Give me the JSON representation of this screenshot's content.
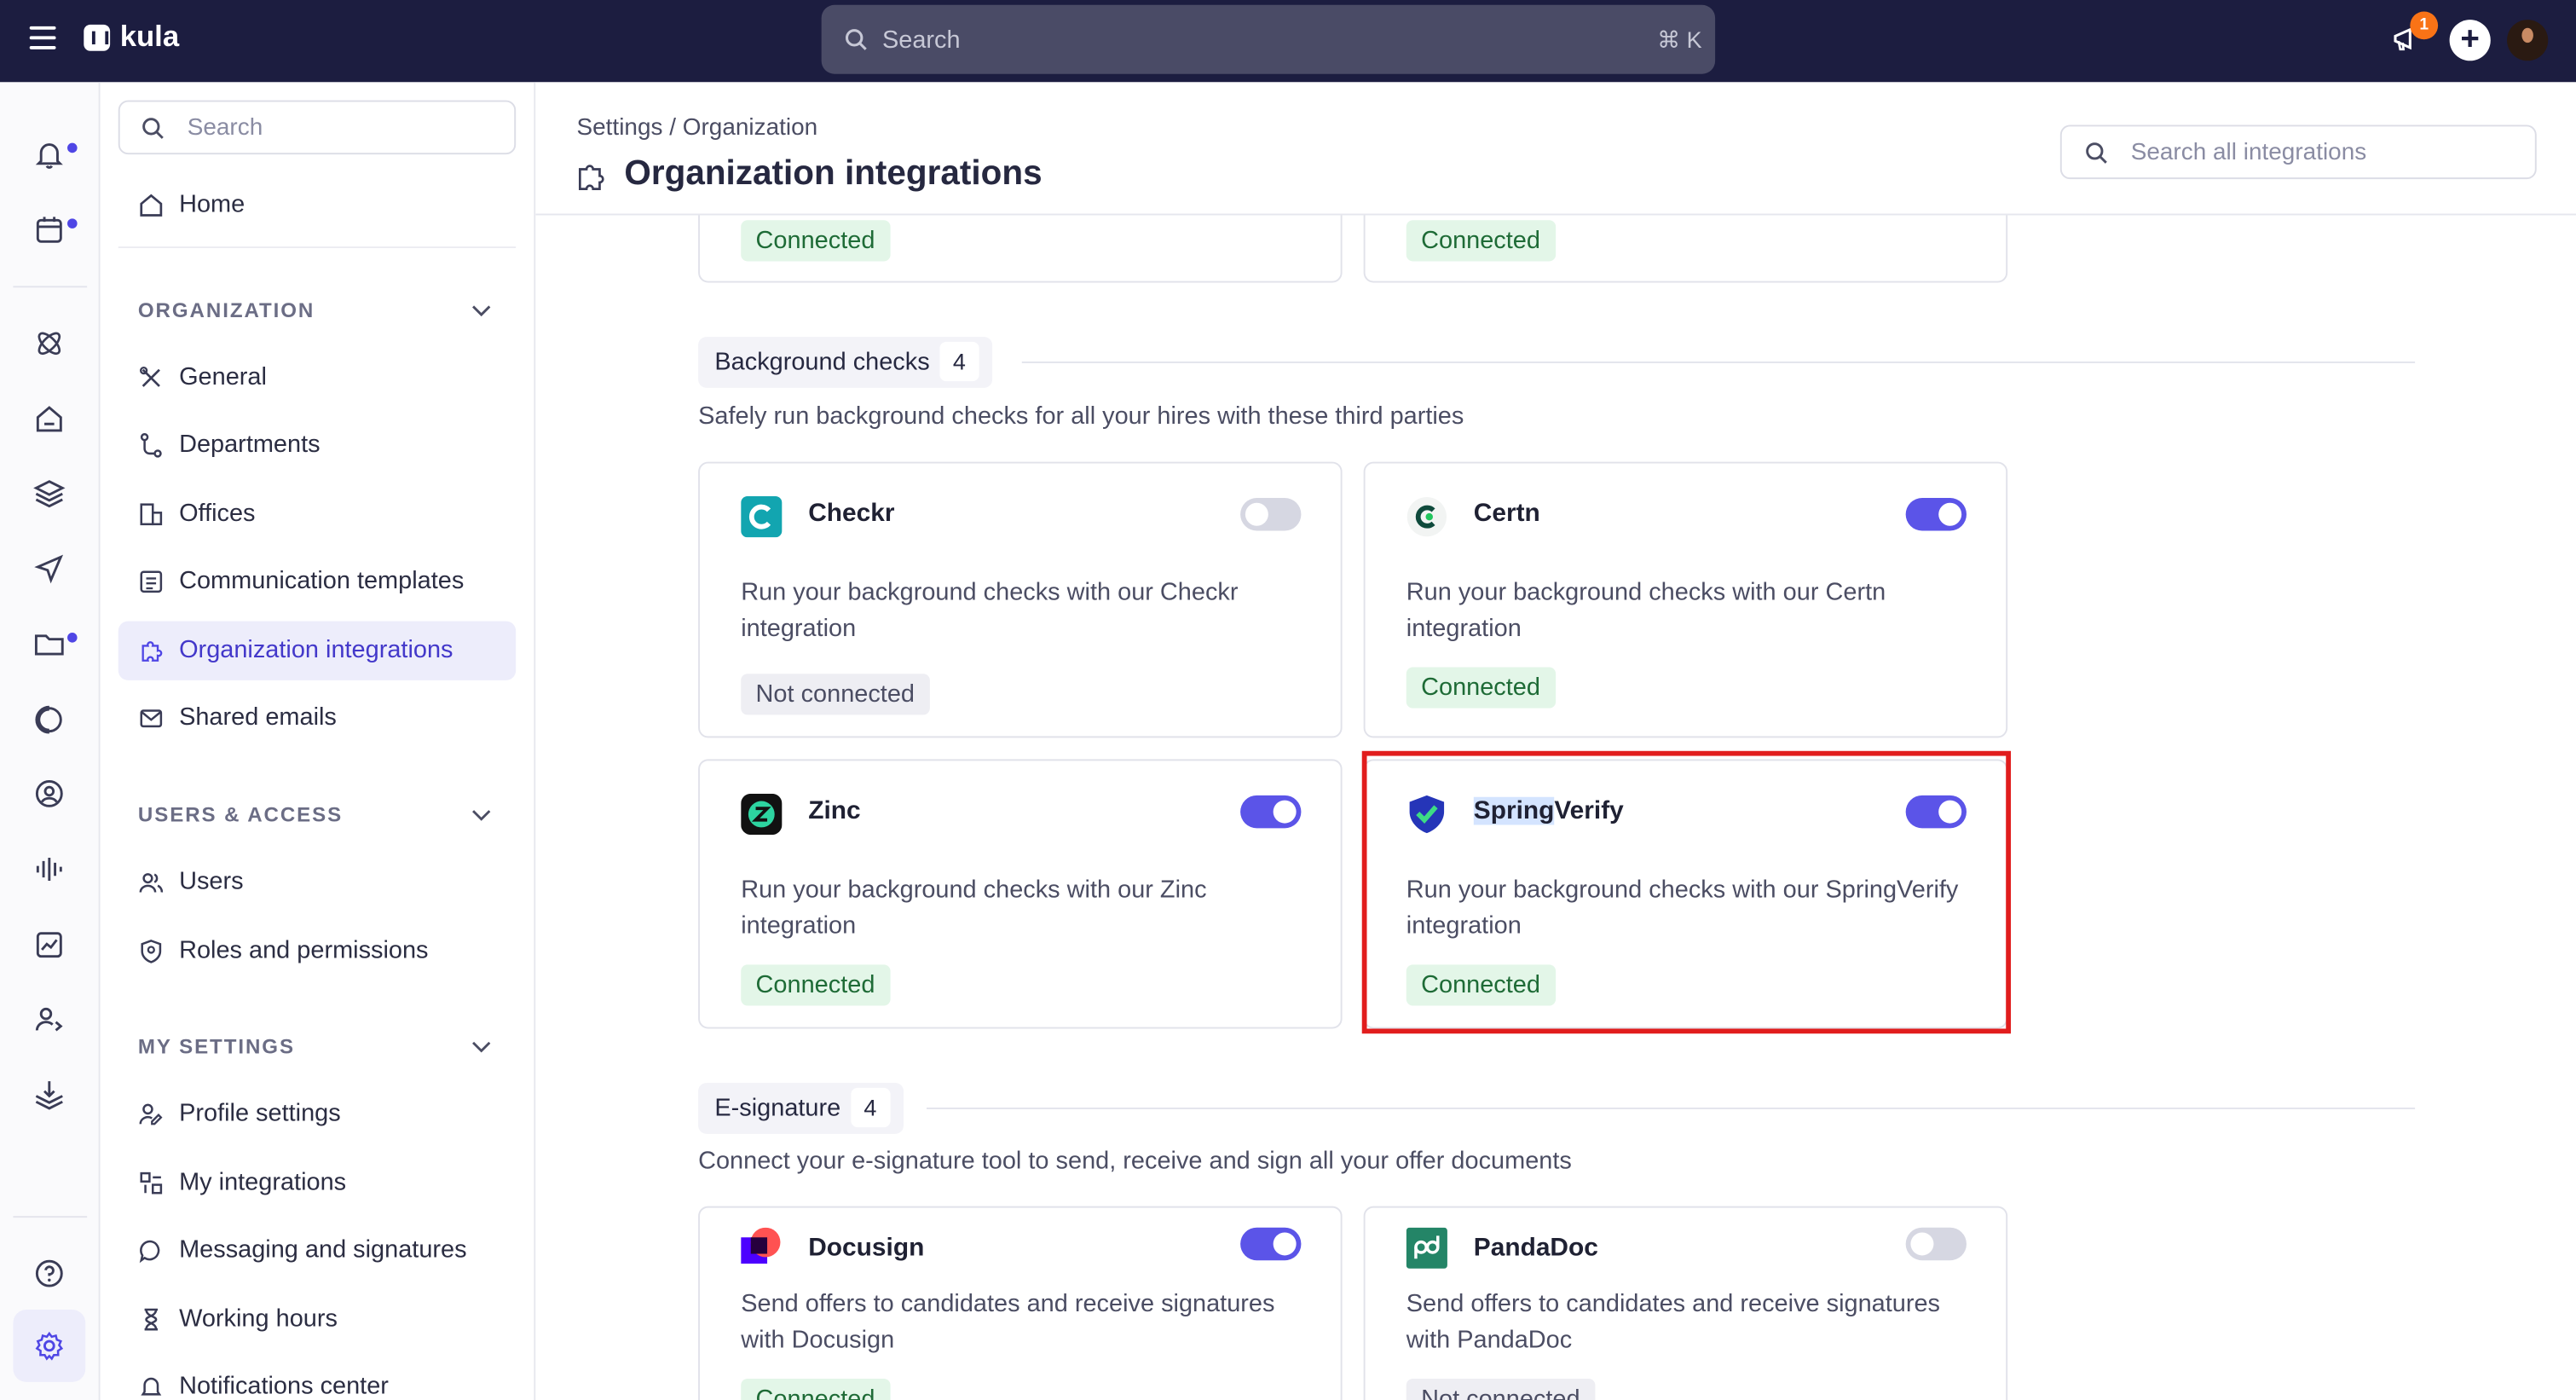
{
  "topbar": {
    "app_name": "kula",
    "search_placeholder": "Search",
    "search_shortcut": "⌘ K",
    "notification_count": "1"
  },
  "sidebar": {
    "search_placeholder": "Search",
    "home": "Home",
    "groups": [
      {
        "title": "ORGANIZATION",
        "items": [
          "General",
          "Departments",
          "Offices",
          "Communication templates",
          "Organization integrations",
          "Shared emails"
        ]
      },
      {
        "title": "USERS & ACCESS",
        "items": [
          "Users",
          "Roles and permissions"
        ]
      },
      {
        "title": "MY SETTINGS",
        "items": [
          "Profile settings",
          "My integrations",
          "Messaging and signatures",
          "Working hours",
          "Notifications center"
        ]
      }
    ]
  },
  "main": {
    "breadcrumb": "Settings / Organization",
    "title": "Organization integrations",
    "search_placeholder": "Search all integrations",
    "previous_section": {
      "statuses": [
        "Connected",
        "Connected"
      ]
    },
    "sections": [
      {
        "title": "Background checks",
        "count": "4",
        "description": "Safely run background checks for all your hires with these third parties",
        "cards": [
          {
            "name": "Checkr",
            "description": "Run your background checks with our Checkr integration",
            "status": "Not connected",
            "enabled": false,
            "icon": "checkr-logo"
          },
          {
            "name": "Certn",
            "description": "Run your background checks with our Certn integration",
            "status": "Connected",
            "enabled": true,
            "icon": "certn-logo"
          },
          {
            "name": "Zinc",
            "description": "Run your background checks with our Zinc integration",
            "status": "Connected",
            "enabled": true,
            "icon": "zinc-logo"
          },
          {
            "name_selected_part": "Spring",
            "name_rest": "Verify",
            "description": "Run your background checks with our SpringVerify integration",
            "status": "Connected",
            "enabled": true,
            "icon": "springverify-logo"
          }
        ]
      },
      {
        "title": "E-signature",
        "count": "4",
        "description": "Connect your e-signature tool to send, receive and sign all your offer documents",
        "cards": [
          {
            "name": "Docusign",
            "description": "Send offers to candidates and receive signatures with Docusign",
            "status": "Connected",
            "enabled": true,
            "icon": "docusign-logo"
          },
          {
            "name": "PandaDoc",
            "description": "Send offers to candidates and receive signatures with PandaDoc",
            "status": "Not connected",
            "enabled": false,
            "icon": "pandadoc-logo"
          }
        ]
      }
    ]
  },
  "colors": {
    "topbar_bg": "#1c1d40",
    "accent": "#5b54e8",
    "connected_bg": "#e3f6e8",
    "connected_text": "#1e6b36",
    "highlight": "#e11d1d"
  }
}
